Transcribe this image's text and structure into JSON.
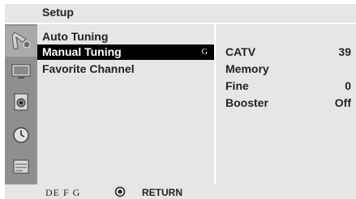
{
  "title": "Setup",
  "sidebar_icons": [
    {
      "name": "setup-icon",
      "active": true
    },
    {
      "name": "picture-icon",
      "active": false
    },
    {
      "name": "audio-icon",
      "active": false
    },
    {
      "name": "time-icon",
      "active": false
    },
    {
      "name": "option-icon",
      "active": false
    }
  ],
  "menu": {
    "items": [
      {
        "label": "Auto Tuning",
        "selected": false
      },
      {
        "label": "Manual Tuning",
        "selected": true,
        "glyph": "G"
      },
      {
        "label": "Favorite Channel",
        "selected": false
      }
    ]
  },
  "submenu": {
    "rows": [
      {
        "label": "CATV",
        "value": "39"
      },
      {
        "label": "Memory",
        "value": ""
      },
      {
        "label": "Fine",
        "value": "0"
      },
      {
        "label": "Booster",
        "value": "Off"
      }
    ]
  },
  "footer": {
    "nav_glyphs": "DE  F G",
    "ok_icon": "ok-icon",
    "return_label": "RETURN"
  },
  "colors": {
    "panel": "#e6e6e6",
    "icon_column": "#8f8f8f",
    "selected_bg": "#000000",
    "selected_text": "#ffffff"
  }
}
